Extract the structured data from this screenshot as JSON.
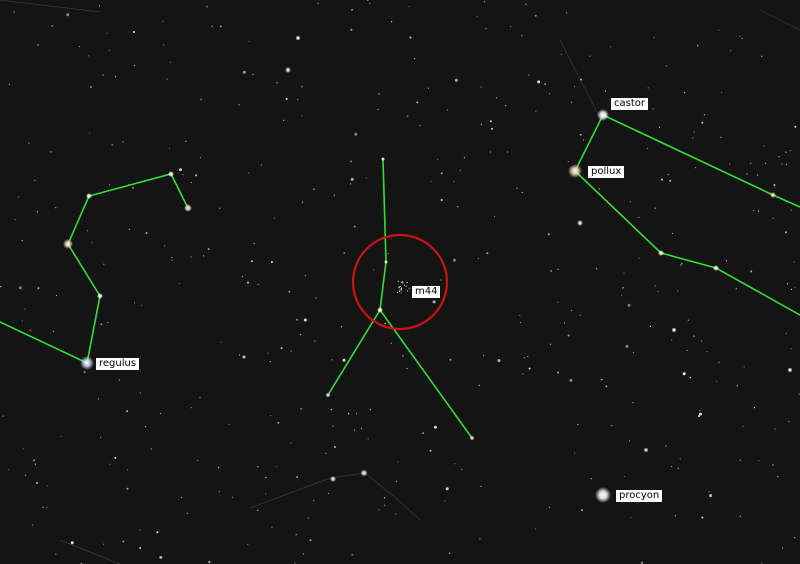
{
  "colors": {
    "background": "#141414",
    "constellation_line": "#33dd33",
    "target_circle": "#cc1111",
    "label_bg": "#ffffff",
    "label_text": "#000000"
  },
  "labels": {
    "castor": "castor",
    "pollux": "pollux",
    "regulus": "regulus",
    "m44": "m44",
    "procyon": "procyon"
  }
}
